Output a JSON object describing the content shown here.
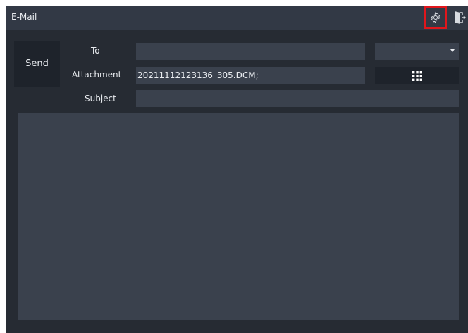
{
  "window": {
    "title": "E-Mail",
    "icons": {
      "settings": "gear-icon",
      "exit": "exit-door-icon"
    }
  },
  "compose": {
    "send_label": "Send",
    "to_label": "To",
    "to_value": "",
    "attachment_label": "Attachment",
    "attachment_value": "20211112123136_305.DCM;",
    "subject_label": "Subject",
    "subject_value": "",
    "body_value": "",
    "recipient_dropdown_value": "",
    "keypad_icon": "keypad-grid-icon"
  },
  "colors": {
    "window_bg": "#262b33",
    "titlebar_bg": "#323945",
    "field_bg": "#3a414d",
    "button_bg": "#1e232b",
    "highlight": "#e0161c",
    "text": "#e8ebef"
  }
}
